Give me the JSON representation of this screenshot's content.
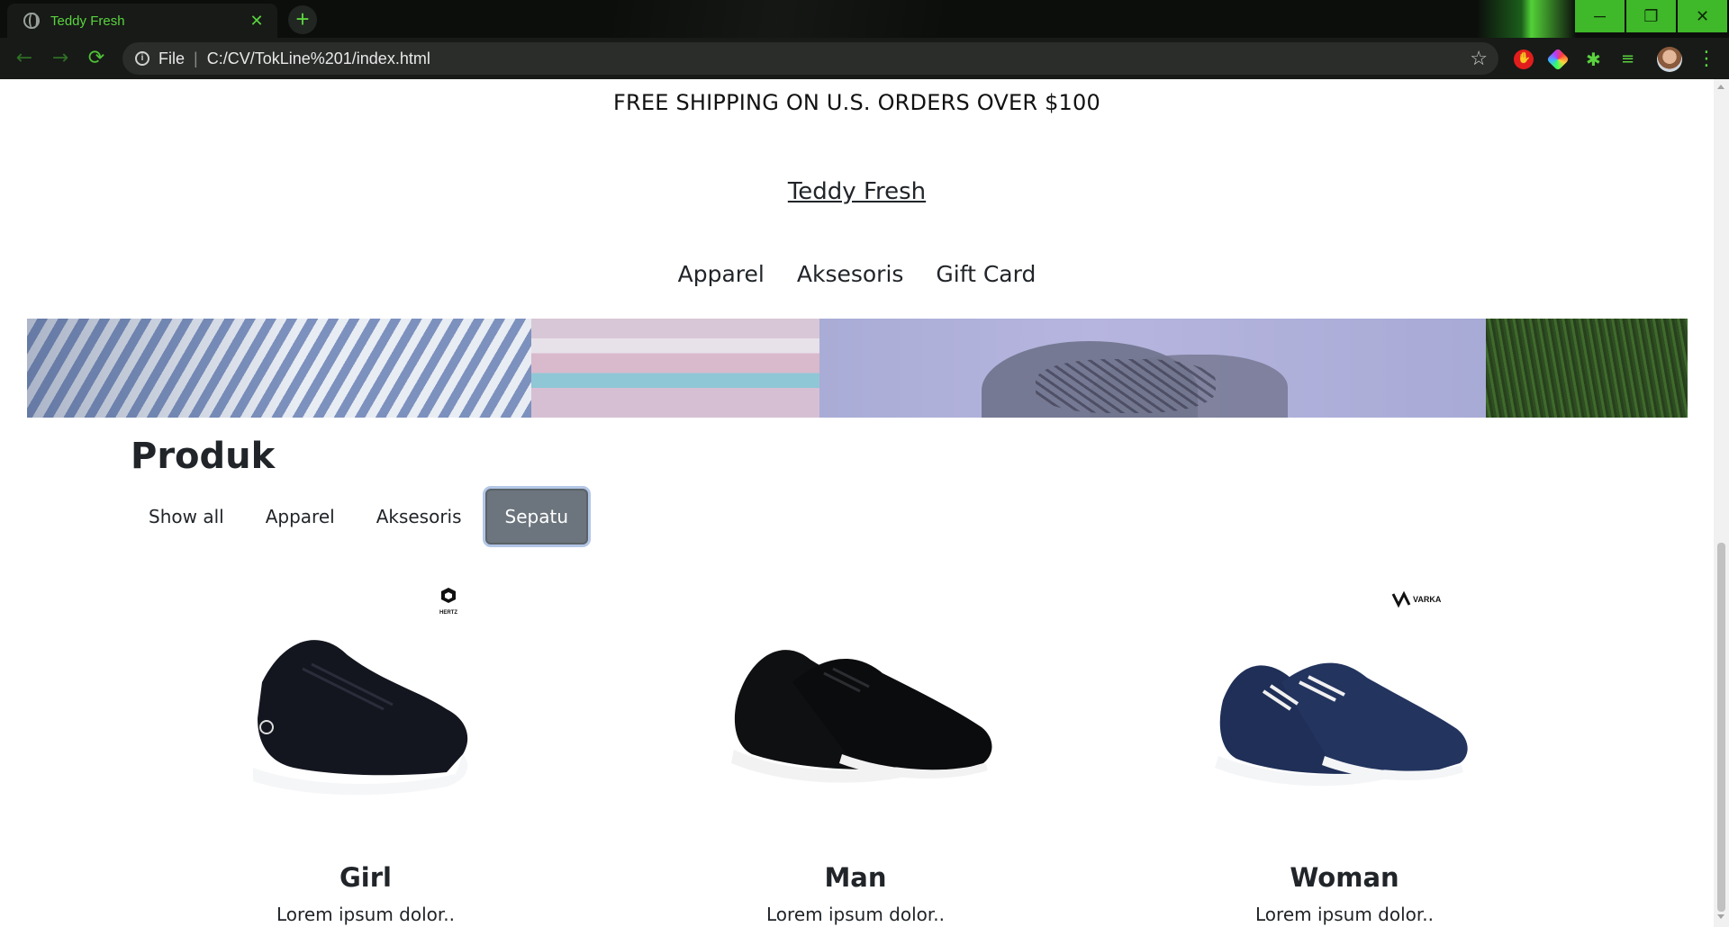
{
  "browser": {
    "tab_title": "Teddy Fresh",
    "tab_close": "✕",
    "new_tab": "+",
    "window_controls": {
      "minimize": "─",
      "maximize": "❐",
      "close": "✕"
    },
    "nav": {
      "back": "←",
      "forward": "→",
      "reload": "⟳"
    },
    "omnibox": {
      "scheme": "File",
      "separator": "|",
      "url": "C:/CV/TokLine%201/index.html",
      "info": "i",
      "bookmark": "☆"
    },
    "extensions": [
      "adblock-icon",
      "color-picker-icon",
      "extensions-puzzle-icon",
      "reading-list-icon"
    ],
    "extension_glyphs": {
      "puzzle": "✱",
      "reading_list": "≡"
    },
    "menu": "⋮",
    "accent_color": "#3fb82a"
  },
  "page": {
    "announcement": "FREE SHIPPING ON U.S. ORDERS OVER $100",
    "brand": "Teddy Fresh",
    "nav_items": [
      "Apparel",
      "Aksesoris",
      "Gift Card"
    ],
    "section_title": "Produk",
    "filters": [
      {
        "label": "Show all",
        "active": false
      },
      {
        "label": "Apparel",
        "active": false
      },
      {
        "label": "Aksesoris",
        "active": false
      },
      {
        "label": "Sepatu",
        "active": true
      }
    ],
    "products": [
      {
        "title": "Girl",
        "text": "Lorem ipsum dolor..",
        "logo": "HERTZ",
        "shoe_color": "#14161f"
      },
      {
        "title": "Man",
        "text": "Lorem ipsum dolor..",
        "logo": "",
        "shoe_color": "#0f1012"
      },
      {
        "title": "Woman",
        "text": "Lorem ipsum dolor..",
        "logo": "VARKA",
        "shoe_color": "#1f2f57"
      }
    ]
  }
}
